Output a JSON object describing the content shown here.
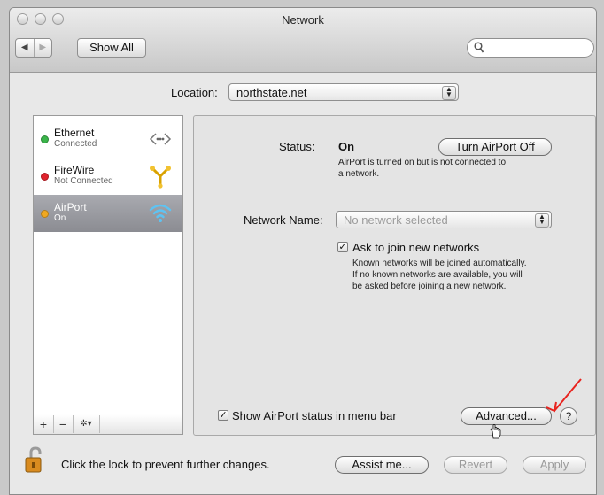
{
  "window": {
    "title": "Network"
  },
  "toolbar": {
    "back_glyph": "◀",
    "forward_glyph": "▶",
    "show_all_label": "Show All",
    "search_placeholder": ""
  },
  "location": {
    "label": "Location:",
    "value": "northstate.net"
  },
  "services": [
    {
      "name": "Ethernet",
      "status": "Connected",
      "status_color": "#3ab54a",
      "icon": "ethernet-icon",
      "selected": false
    },
    {
      "name": "FireWire",
      "status": "Not Connected",
      "status_color": "#e0232d",
      "icon": "firewire-icon",
      "selected": false
    },
    {
      "name": "AirPort",
      "status": "On",
      "status_color": "#f0a820",
      "icon": "airport-wifi-icon",
      "selected": true
    }
  ],
  "sidebar_tools": {
    "add": "+",
    "remove": "−",
    "action": "✲▾"
  },
  "detail": {
    "status_label": "Status:",
    "status_value": "On",
    "turn_off_button": "Turn AirPort Off",
    "status_message_line1": "AirPort is turned on but is not connected to",
    "status_message_line2": "a network.",
    "network_name_label": "Network Name:",
    "network_name_placeholder": "No network selected",
    "ask_to_join_label": "Ask to join new networks",
    "ask_to_join_checked": true,
    "ask_help_line1": "Known networks will be joined automatically.",
    "ask_help_line2": "If no known networks are available, you will",
    "ask_help_line3": "be asked before joining a new network.",
    "show_status_label": "Show AirPort status in menu bar",
    "show_status_checked": true,
    "advanced_button": "Advanced...",
    "help_button": "?"
  },
  "footer": {
    "lock_text": "Click the lock to prevent further changes.",
    "assist_button": "Assist me...",
    "revert_button": "Revert",
    "apply_button": "Apply"
  },
  "colors": {
    "annotation_arrow": "#e8231e",
    "selection": "#9a9ba1"
  }
}
